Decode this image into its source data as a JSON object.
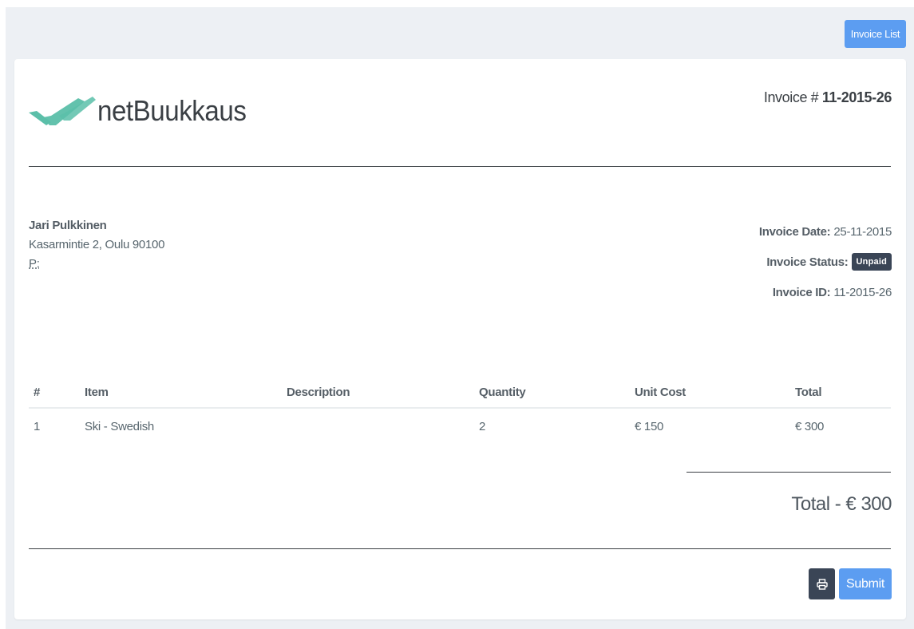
{
  "header": {
    "invoice_list_label": "Invoice List"
  },
  "brand": {
    "name": "netBuukkaus",
    "logo_color": "#5bbfa9"
  },
  "invoice": {
    "number_prefix": "Invoice #",
    "number": "11-2015-26"
  },
  "client": {
    "name": "Jari Pulkkinen",
    "address": "Kasarmintie 2, Oulu 90100",
    "phone_label": "P:"
  },
  "meta": {
    "date_label": "Invoice Date:",
    "date_value": "25-11-2015",
    "status_label": "Invoice Status:",
    "status_value": "Unpaid",
    "id_label": "Invoice ID:",
    "id_value": "11-2015-26"
  },
  "table": {
    "columns": [
      "#",
      "Item",
      "Description",
      "Quantity",
      "Unit Cost",
      "Total"
    ],
    "rows": [
      [
        "1",
        "Ski - Swedish",
        "",
        "2",
        "€ 150",
        "€ 300"
      ]
    ]
  },
  "total_text": "Total - € 300",
  "actions": {
    "print_icon": "print-icon",
    "submit_label": "Submit"
  },
  "colors": {
    "primary": "#5c9df1",
    "dark": "#3a4556",
    "background": "#edf0f4"
  }
}
